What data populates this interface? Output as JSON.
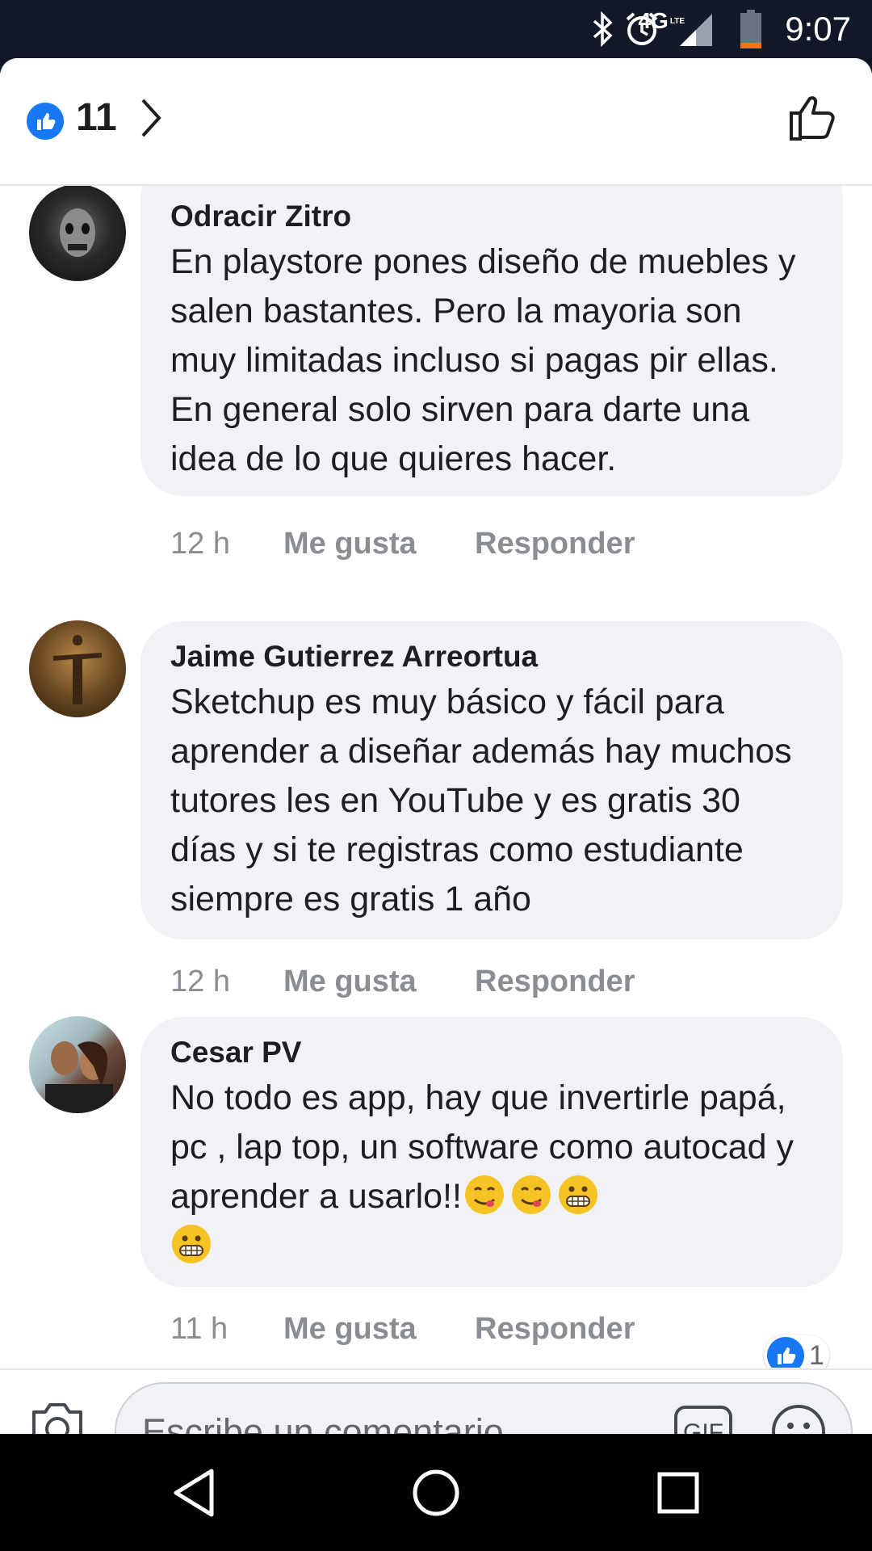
{
  "status_bar": {
    "network": "4G",
    "network_sub": "LTE",
    "time": "9:07",
    "icons": [
      "bluetooth-icon",
      "alarm-icon",
      "signal-icon",
      "battery-icon"
    ]
  },
  "header": {
    "reaction_count": "11"
  },
  "comments": [
    {
      "author": "Odracir Zitro",
      "text": "En playstore pones diseño de muebles y salen bastantes. Pero la mayoria son muy limitadas incluso si pagas pir ellas. En general solo sirven para darte una idea de lo que quieres hacer.",
      "time": "12 h",
      "like_label": "Me gusta",
      "reply_label": "Responder"
    },
    {
      "author": "Jaime Gutierrez Arreortua",
      "text": "Sketchup es muy  básico y fácil  para aprender a diseñar además hay muchos tutores les en YouTube y es gratis 30 días y si te registras como estudiante siempre es gratis 1 año",
      "time": "12 h",
      "like_label": "Me gusta",
      "reply_label": "Responder"
    },
    {
      "author": "Cesar PV",
      "text": "No todo es app, hay que invertirle papá, pc , lap top, un software como autocad y aprender a usarlo!!",
      "emojis": [
        "😋",
        "😋",
        "😁",
        "😁"
      ],
      "time": "11 h",
      "like_label": "Me gusta",
      "reply_label": "Responder",
      "reaction_count": "1"
    }
  ],
  "composer": {
    "placeholder": "Escribe un comentario...",
    "gif_label": "GIF"
  },
  "colors": {
    "accent": "#1877f2",
    "bubble": "#f0f2f5",
    "meta_text": "#8a8d91",
    "status_bar": "#111827"
  }
}
